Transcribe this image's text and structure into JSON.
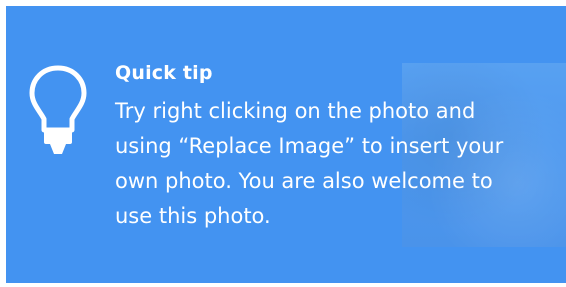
{
  "tip": {
    "title": "Quick tip",
    "lines": [
      "Try right clicking on the photo and",
      "using “Replace Image” to insert your",
      "own photo. You are also welcome to",
      "use this photo."
    ],
    "icon": "lightbulb-icon"
  },
  "colors": {
    "card_background": "#4393f1",
    "text": "#ffffff"
  }
}
